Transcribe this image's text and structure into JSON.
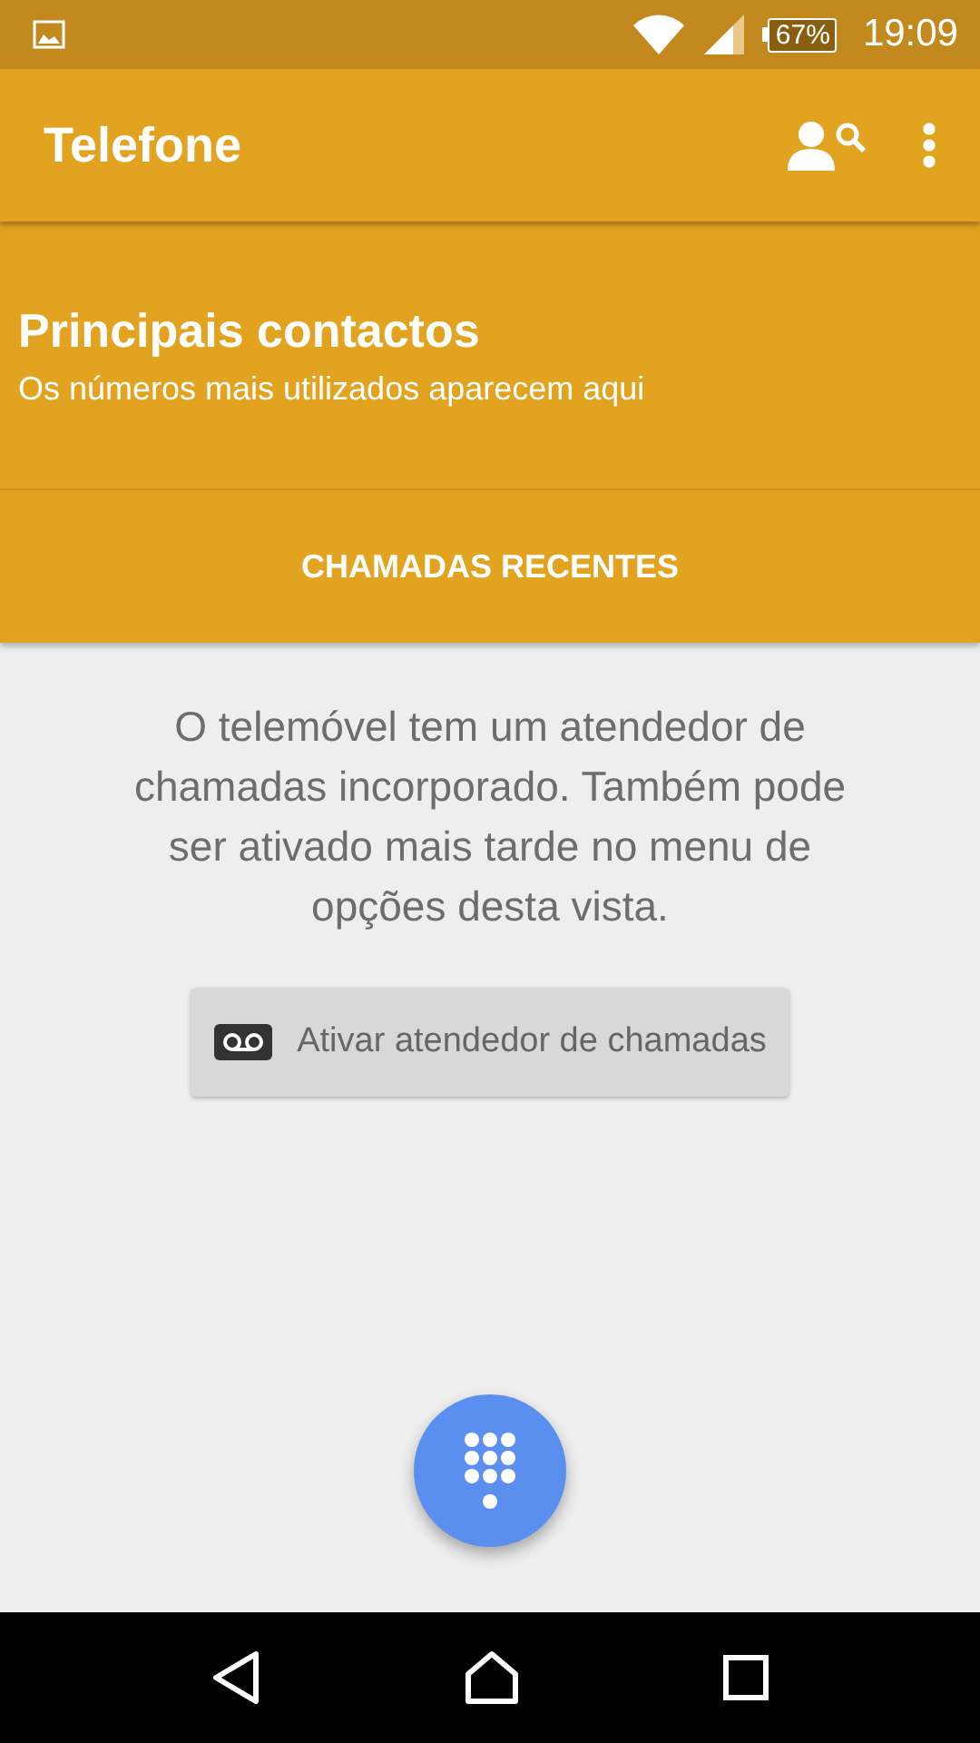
{
  "status_bar": {
    "battery": "67%",
    "time": "19:09"
  },
  "app_bar": {
    "title": "Telefone"
  },
  "favorites": {
    "title": "Principais contactos",
    "subtitle": "Os números mais utilizados aparecem aqui"
  },
  "recent_calls_header": "CHAMADAS RECENTES",
  "message": "O telemóvel tem um atendedor de chamadas incorporado. Também pode ser ativado mais tarde no menu de opções desta vista.",
  "voicemail_button": "Ativar atendedor de chamadas"
}
